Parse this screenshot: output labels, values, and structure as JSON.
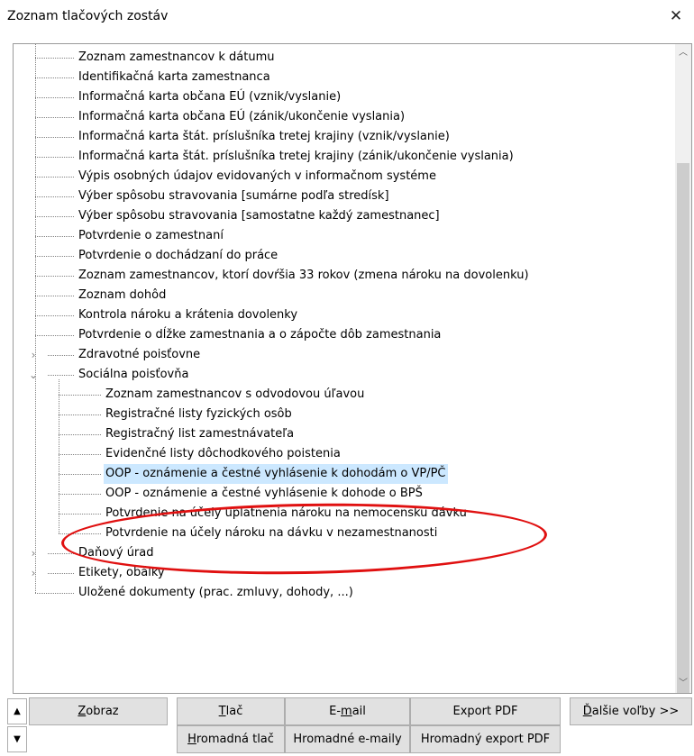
{
  "window": {
    "title": "Zoznam tlačových zostáv",
    "close_glyph": "✕"
  },
  "tree": {
    "items": [
      {
        "label": "Zoznam zamestnancov k dátumu",
        "level": 1
      },
      {
        "label": "Identifikačná karta zamestnanca",
        "level": 1
      },
      {
        "label": "Informačná karta občana EÚ (vznik/vyslanie)",
        "level": 1
      },
      {
        "label": "Informačná karta občana EÚ (zánik/ukončenie vyslania)",
        "level": 1
      },
      {
        "label": "Informačná karta štát. príslušníka tretej krajiny (vznik/vyslanie)",
        "level": 1
      },
      {
        "label": "Informačná karta štát. príslušníka tretej krajiny (zánik/ukončenie vyslania)",
        "level": 1
      },
      {
        "label": "Výpis osobných údajov evidovaných v informačnom systéme",
        "level": 1
      },
      {
        "label": "Výber spôsobu stravovania [sumárne podľa stredísk]",
        "level": 1
      },
      {
        "label": "Výber spôsobu stravovania [samostatne každý zamestnanec]",
        "level": 1
      },
      {
        "label": "Potvrdenie o zamestnaní",
        "level": 1
      },
      {
        "label": "Potvrdenie o dochádzaní do práce",
        "level": 1
      },
      {
        "label": "Zoznam zamestnancov, ktorí dovŕšia 33 rokov (zmena nároku na dovolenku)",
        "level": 1
      },
      {
        "label": "Zoznam dohôd",
        "level": 1
      },
      {
        "label": "Kontrola nároku a krátenia dovolenky",
        "level": 1
      },
      {
        "label": "Potvrdenie o dĺžke zamestnania a o zápočte dôb zamestnania",
        "level": 1
      },
      {
        "label": "Zdravotné poisťovne",
        "level": 1,
        "expander": "collapsed"
      },
      {
        "label": "Sociálna poisťovňa",
        "level": 1,
        "expander": "expanded"
      },
      {
        "label": "Zoznam zamestnancov s odvodovou úľavou",
        "level": 2
      },
      {
        "label": "Registračné listy fyzických osôb",
        "level": 2
      },
      {
        "label": "Registračný list zamestnávateľa",
        "level": 2
      },
      {
        "label": "Evidenčné listy dôchodkového poistenia",
        "level": 2
      },
      {
        "label": "OOP - oznámenie a čestné vyhlásenie k dohodám o VP/PČ",
        "level": 2,
        "selected": true
      },
      {
        "label": "OOP - oznámenie a čestné vyhlásenie k dohode o BPŠ",
        "level": 2
      },
      {
        "label": "Potvrdenie na účely uplatnenia nároku na nemocenskú dávku",
        "level": 2
      },
      {
        "label": "Potvrdenie na účely nároku na dávku v nezamestnanosti",
        "level": 2
      },
      {
        "label": "Daňový úrad",
        "level": 1,
        "expander": "collapsed"
      },
      {
        "label": "Etikety, obálky",
        "level": 1,
        "expander": "collapsed"
      },
      {
        "label": "Uložené dokumenty (prac. zmluvy, dohody, ...)",
        "level": 1
      }
    ],
    "expander_collapsed_glyph": "›",
    "expander_expanded_glyph": "⌄",
    "scroll_up_glyph": "︿",
    "scroll_down_glyph": "﹀"
  },
  "buttons": {
    "scroll_up_glyph": "▲",
    "scroll_down_glyph": "▼",
    "zobraz": {
      "key": "Z",
      "rest": "obraz"
    },
    "tlac": {
      "key": "T",
      "rest": "lač"
    },
    "email": {
      "pre": "E-",
      "key": "m",
      "rest": "ail"
    },
    "export_pdf": "Export PDF",
    "dalsie": {
      "key": "Ď",
      "rest": "alšie voľby >>"
    },
    "hromadna_tlac": {
      "key": "H",
      "rest": "romadná tlač"
    },
    "hromadne_emaily": "Hromadné e-maily",
    "hromadny_export": "Hromadný export PDF"
  },
  "colors": {
    "selection": "#cce8ff",
    "annotation": "#e01010"
  }
}
